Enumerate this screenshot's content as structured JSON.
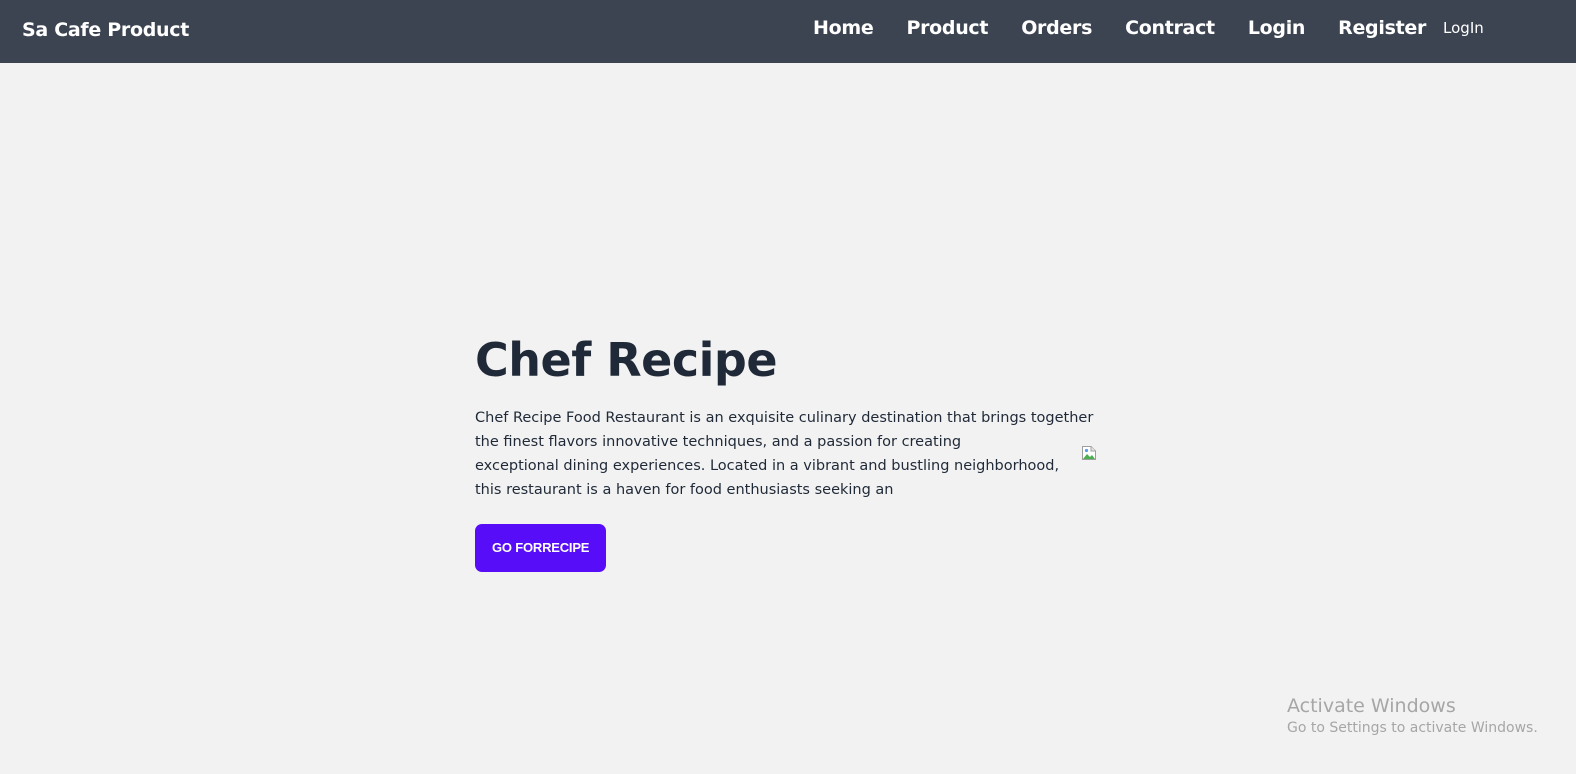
{
  "navbar": {
    "brand": "Sa Cafe Product",
    "links": [
      "Home",
      "Product",
      "Orders",
      "Contract",
      "Login",
      "Register"
    ],
    "extra_link": "LogIn",
    "background": "#3d4451"
  },
  "hero": {
    "title": "Chef Recipe",
    "description_lines": [
      "Chef Recipe Food Restaurant is an exquisite culinary destination that brings together",
      "the finest flavors innovative techniques, and a passion for creating",
      "exceptional dining experiences. Located in a vibrant and bustling neighborhood,",
      "this restaurant is a haven for food enthusiasts seeking an"
    ],
    "button_label": "GO FORRECIPE",
    "button_color": "#570df8",
    "image_icon": "broken-image-icon"
  },
  "watermark": {
    "title": "Activate Windows",
    "subtitle": "Go to Settings to activate Windows."
  }
}
